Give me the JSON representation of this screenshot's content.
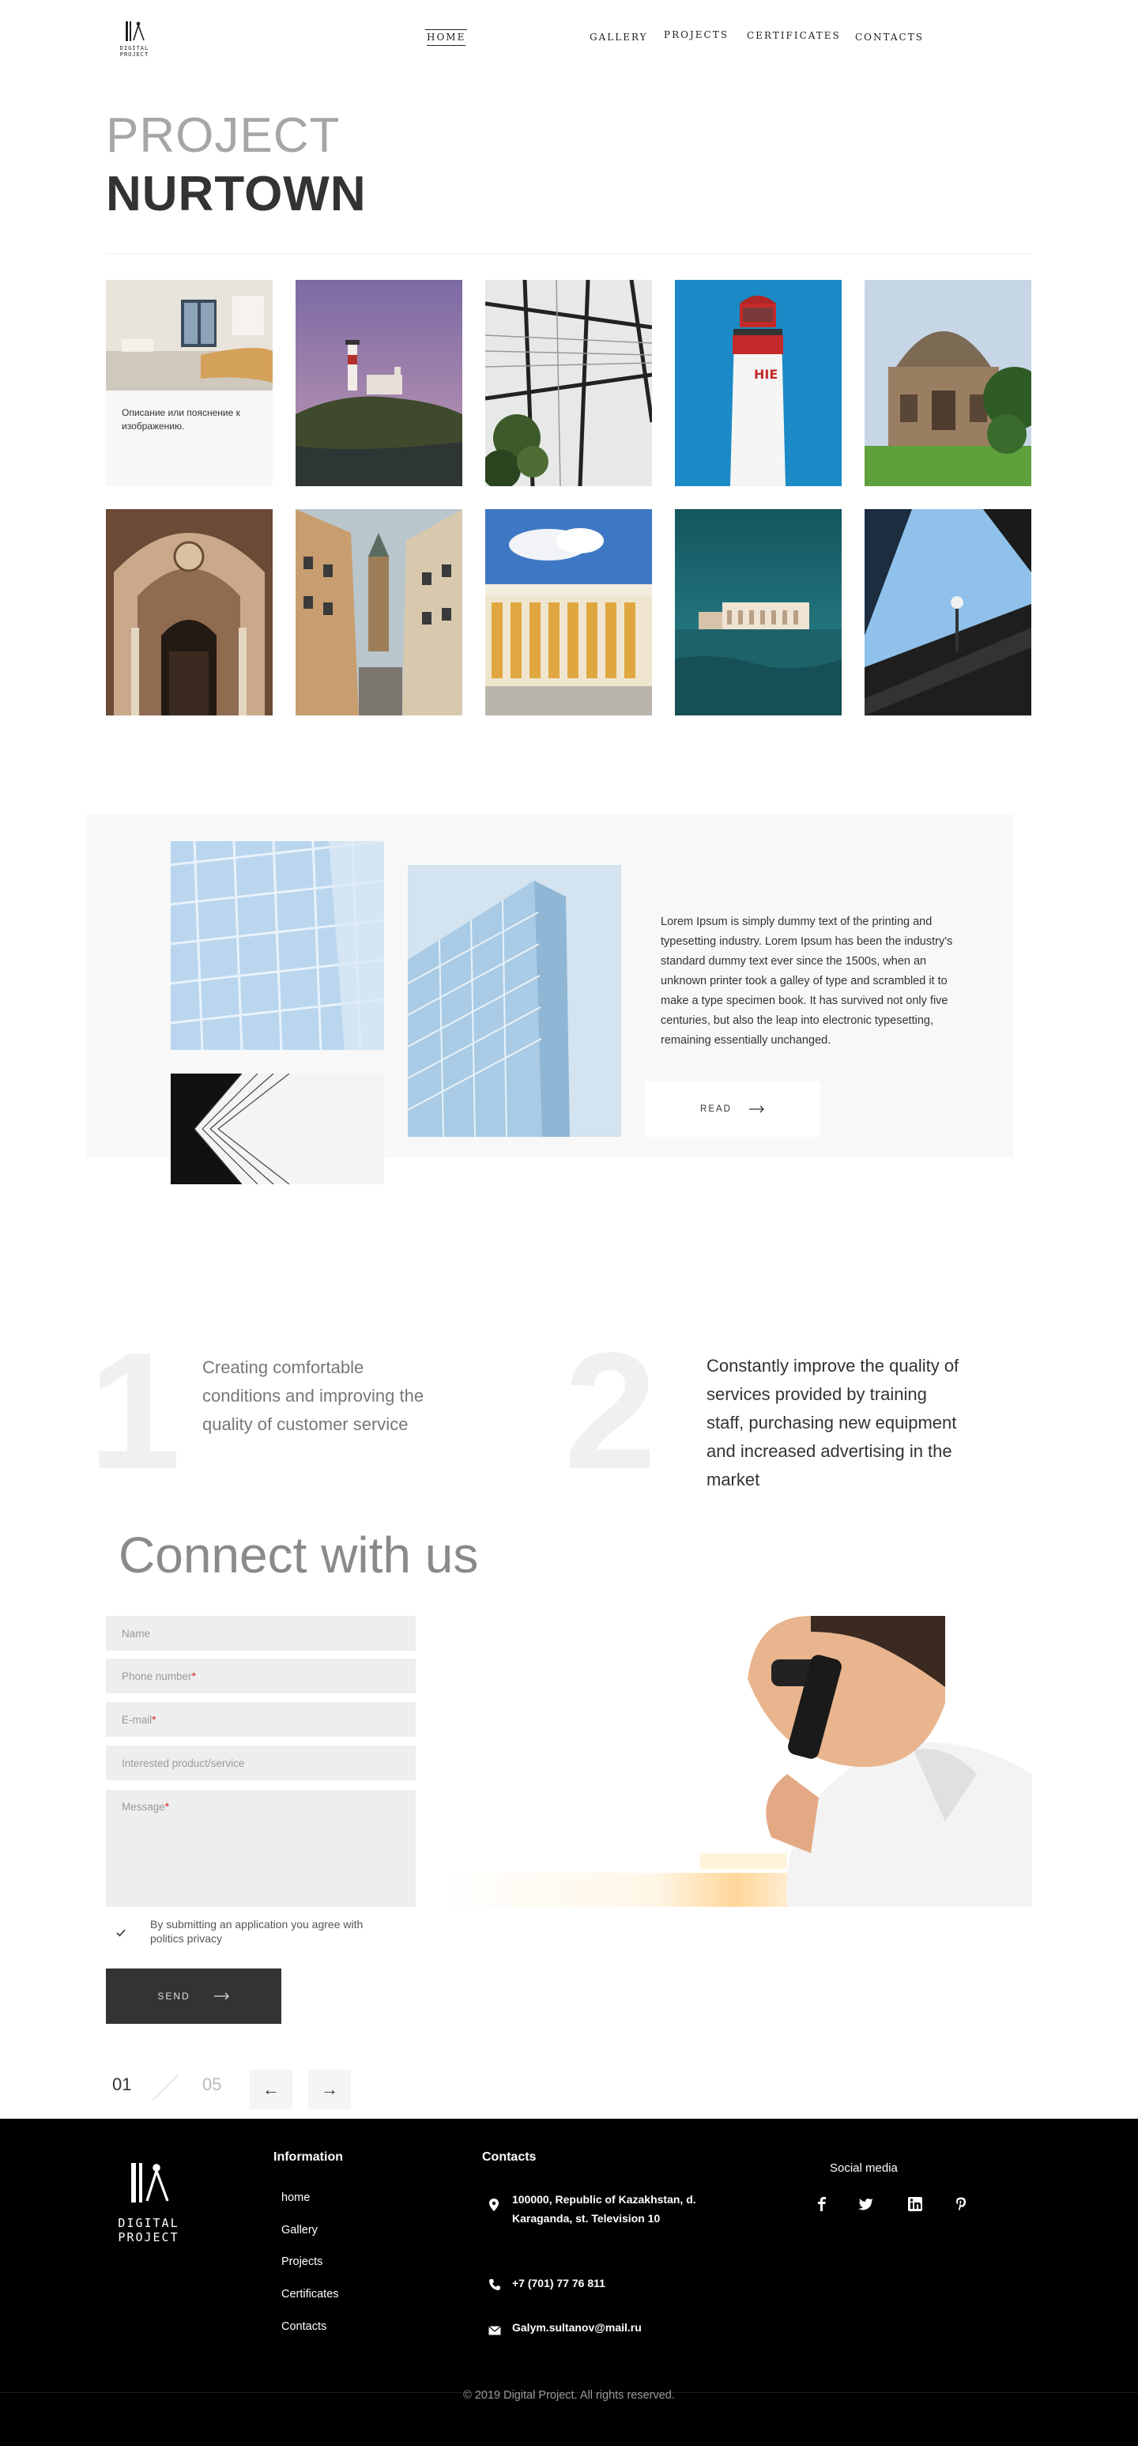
{
  "header": {
    "logo_text": "DIGITAL PROJECT",
    "nav": [
      "HOME",
      "GALLERY",
      "PROJECTS",
      "CERTIFICATES",
      "CONTACTS"
    ]
  },
  "project": {
    "label": "PROJECT",
    "name": "NURTOWN"
  },
  "gallery": {
    "caption": "Описание или пояснение к изображению.",
    "items": [
      "lobby",
      "lighthouse-hill",
      "glass-roof",
      "lighthouse-red",
      "mausoleum",
      "arch-doorway",
      "city-street",
      "colonnade",
      "palace-waterfront",
      "tower-sky"
    ]
  },
  "feature": {
    "text": "Lorem Ipsum is simply dummy text of the printing and typesetting industry. Lorem Ipsum has been the industry's standard dummy text ever since the 1500s, when an unknown printer took a galley of type and scrambled it to make a type specimen book. It has survived not only five centuries, but also the leap into electronic typesetting, remaining essentially unchanged.",
    "button": "READ"
  },
  "stats": [
    {
      "number": "1",
      "text": "Creating comfortable conditions and improving the quality of customer service"
    },
    {
      "number": "2",
      "text": "Constantly improve the quality of services provided by training staff, purchasing new equipment and increased advertising in the market"
    }
  ],
  "contact_form": {
    "title": "Connect with us",
    "name_placeholder": "Name",
    "phone_placeholder": "Phone number",
    "email_placeholder": "E-mail",
    "product_placeholder": "Interested product/service",
    "message_placeholder": "Message",
    "required_mark": "*",
    "agree_text": "By submitting an application you agree with politics privacy",
    "send": "SEND"
  },
  "pager": {
    "current": "01",
    "total": "05",
    "prev": "←",
    "next": "→"
  },
  "footer": {
    "logo_text": "DIGITAL PROJECT",
    "information_heading": "Information",
    "links": [
      "home",
      "Gallery",
      "Projects",
      "Certificates",
      "Contacts"
    ],
    "contacts_heading": "Contacts",
    "address": "100000, Republic of Kazakhstan, d. Karaganda, st. Television 10",
    "phone": "+7 (701) 77 76 811",
    "email": "Galym.sultanov@mail.ru",
    "social_heading": "Social media",
    "social": [
      "facebook-icon",
      "twitter-icon",
      "linkedin-icon",
      "pinterest-icon"
    ],
    "copyright": "© 2019 Digital Project. All rights reserved."
  },
  "colors": {
    "accent_dark": "#333333",
    "required": "#d32020",
    "footer_bg": "#000000"
  }
}
